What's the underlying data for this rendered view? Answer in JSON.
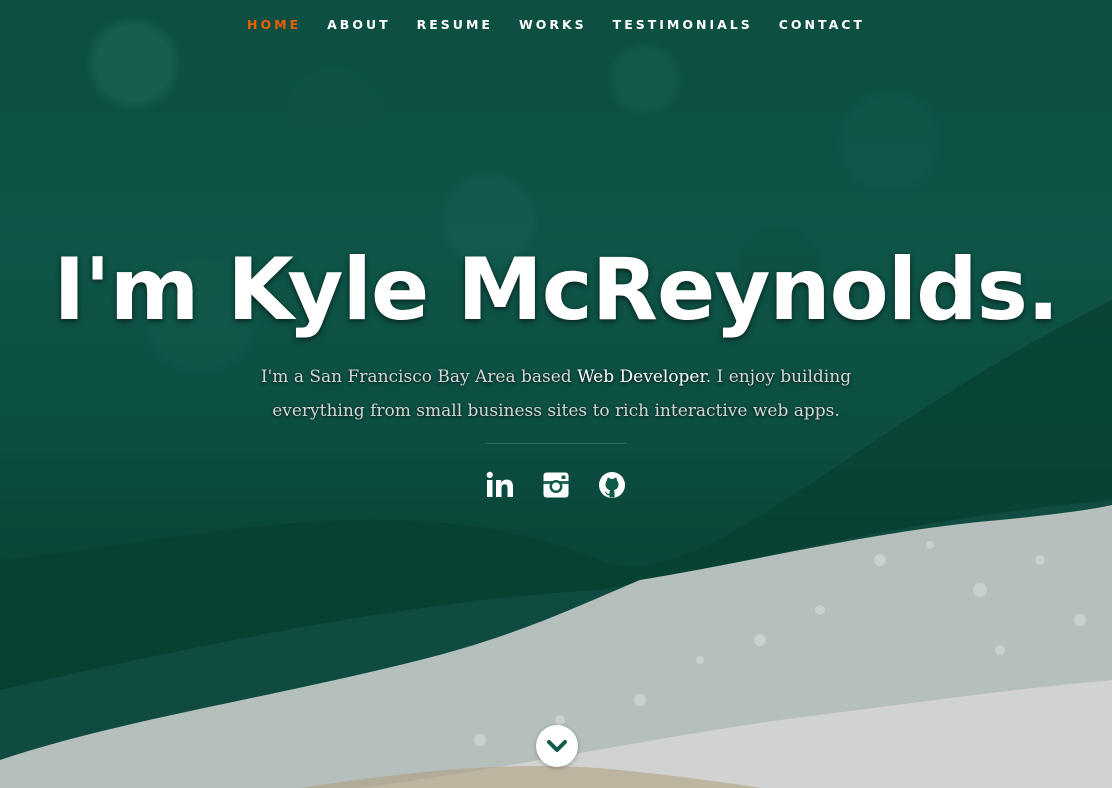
{
  "nav": {
    "items": [
      {
        "label": "HOME",
        "active": true
      },
      {
        "label": "ABOUT",
        "active": false
      },
      {
        "label": "RESUME",
        "active": false
      },
      {
        "label": "WORKS",
        "active": false
      },
      {
        "label": "TESTIMONIALS",
        "active": false
      },
      {
        "label": "CONTACT",
        "active": false
      }
    ],
    "active_color": "#F06000"
  },
  "banner": {
    "headline": "I'm Kyle McReynolds.",
    "intro_before": "I'm a San Francisco Bay Area based ",
    "intro_highlight": "Web Developer",
    "intro_after": ". I enjoy building everything from small business sites to rich interactive web apps."
  },
  "social": [
    {
      "icon": "linkedin-icon"
    },
    {
      "icon": "instagram-icon"
    },
    {
      "icon": "github-icon"
    }
  ],
  "scroll_button": {
    "icon": "chevron-down-icon"
  }
}
